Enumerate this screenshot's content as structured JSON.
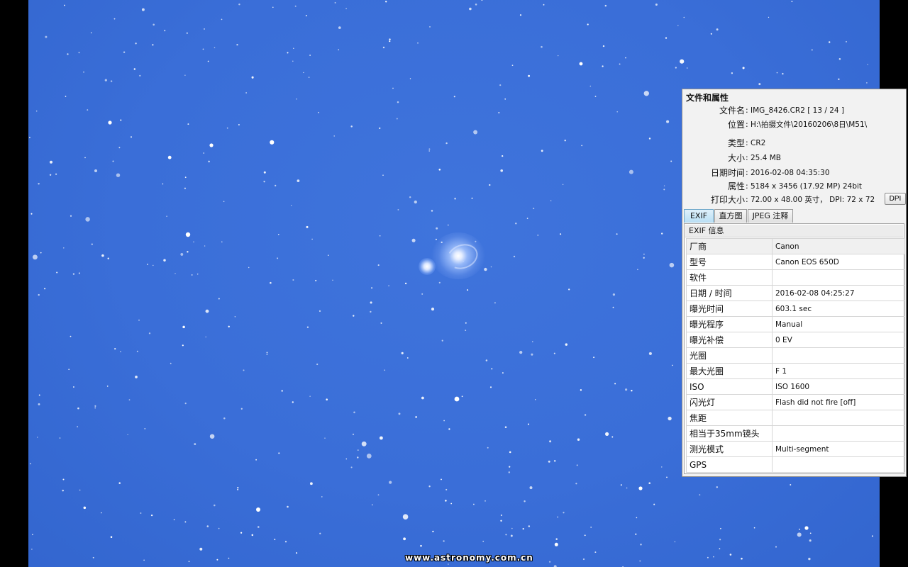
{
  "watermark": "www.astronomy.com.cn",
  "panel": {
    "title": "文件和属性",
    "props": [
      {
        "label": "文件名",
        "value": "IMG_8426.CR2   [ 13 / 24 ]"
      },
      {
        "label": "位置",
        "value": "H:\\拍摄文件\\20160206\\8日\\M51\\"
      },
      {
        "label": "类型",
        "value": "CR2"
      },
      {
        "label": "大小",
        "value": "25.4 MB"
      },
      {
        "label": "日期时间",
        "value": "2016-02-08 04:35:30"
      },
      {
        "label": "属性",
        "value": "5184 x 3456 (17.92 MP)  24bit"
      },
      {
        "label": "打印大小",
        "value": "72.00 x 48.00 英寸，  DPI: 72 x 72"
      }
    ],
    "dpi_button": "DPI",
    "tabs": [
      "EXIF",
      "直方图",
      "JPEG 注释"
    ],
    "active_tab": 0,
    "exif_header": "EXIF 信息",
    "exif": [
      {
        "key": "厂商",
        "value": "Canon"
      },
      {
        "key": "型号",
        "value": "Canon EOS 650D"
      },
      {
        "key": "软件",
        "value": ""
      },
      {
        "key": "日期 / 时间",
        "value": "2016-02-08 04:25:27"
      },
      {
        "key": "曝光时间",
        "value": "603.1 sec"
      },
      {
        "key": "曝光程序",
        "value": "Manual"
      },
      {
        "key": "曝光补偿",
        "value": "0 EV"
      },
      {
        "key": "光圈",
        "value": ""
      },
      {
        "key": "最大光圈",
        "value": "F 1"
      },
      {
        "key": "ISO",
        "value": "ISO 1600"
      },
      {
        "key": "闪光灯",
        "value": "Flash did not fire [off]"
      },
      {
        "key": "焦距",
        "value": ""
      },
      {
        "key": "相当于35mm镜头",
        "value": ""
      },
      {
        "key": "测光模式",
        "value": "Multi-segment"
      },
      {
        "key": "GPS",
        "value": ""
      }
    ]
  }
}
